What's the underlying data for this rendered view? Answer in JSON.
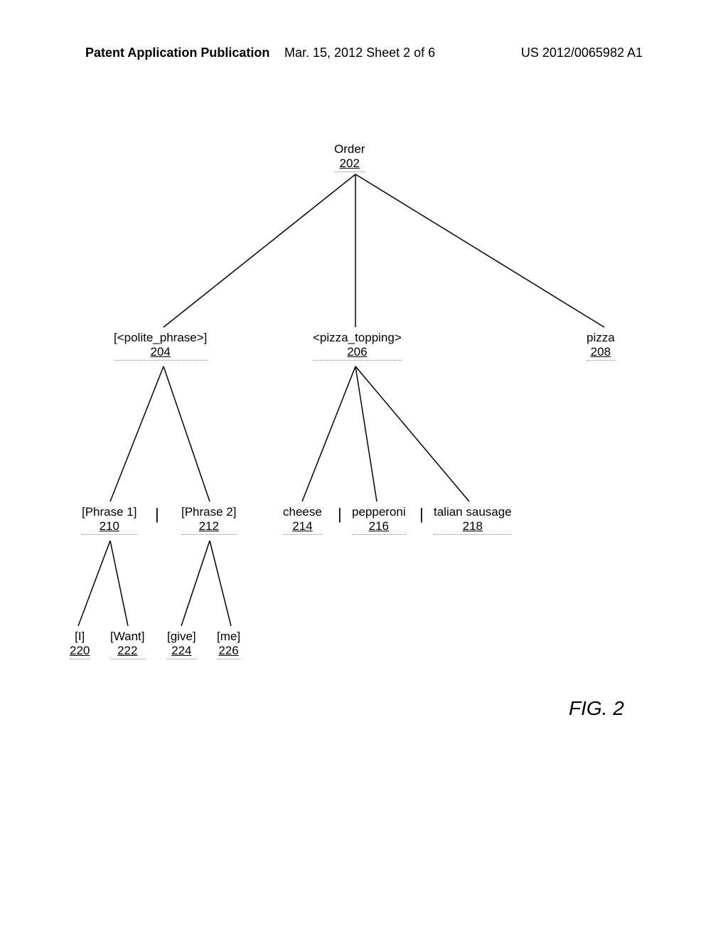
{
  "header": {
    "left": "Patent Application Publication",
    "center": "Mar. 15, 2012  Sheet 2 of 6",
    "right": "US 2012/0065982 A1"
  },
  "nodes": {
    "n202": {
      "label": "Order",
      "ref": "202"
    },
    "n204": {
      "label": "[<polite_phrase>]",
      "ref": "204"
    },
    "n206": {
      "label": "<pizza_topping>",
      "ref": "206"
    },
    "n208": {
      "label": "pizza",
      "ref": "208"
    },
    "n210": {
      "label": "[Phrase 1]",
      "ref": "210"
    },
    "n212": {
      "label": "[Phrase 2]",
      "ref": "212"
    },
    "n214": {
      "label": "cheese",
      "ref": "214"
    },
    "n216": {
      "label": "pepperoni",
      "ref": "216"
    },
    "n218": {
      "label": "talian sausage",
      "ref": "218"
    },
    "n220": {
      "label": "[I]",
      "ref": "220"
    },
    "n222": {
      "label": "[Want]",
      "ref": "222"
    },
    "n224": {
      "label": "[give]",
      "ref": "224"
    },
    "n226": {
      "label": "[me]",
      "ref": "226"
    }
  },
  "separators": {
    "s1": "|",
    "s2": "|",
    "s3": "|"
  },
  "figure_label": "FIG. 2",
  "chart_data": {
    "type": "table",
    "title": "Grammar parse tree for Order",
    "nodes": [
      {
        "id": 202,
        "label": "Order",
        "children": [
          204,
          206,
          208
        ]
      },
      {
        "id": 204,
        "label": "[<polite_phrase>]",
        "children": [
          210,
          212
        ]
      },
      {
        "id": 206,
        "label": "<pizza_topping>",
        "children": [
          214,
          216,
          218
        ]
      },
      {
        "id": 208,
        "label": "pizza",
        "children": []
      },
      {
        "id": 210,
        "label": "[Phrase 1]",
        "children": [
          220,
          222
        ]
      },
      {
        "id": 212,
        "label": "[Phrase 2]",
        "children": [
          224,
          226
        ]
      },
      {
        "id": 214,
        "label": "cheese",
        "children": []
      },
      {
        "id": 216,
        "label": "pepperoni",
        "children": []
      },
      {
        "id": 218,
        "label": "talian sausage",
        "children": []
      },
      {
        "id": 220,
        "label": "[I]",
        "children": []
      },
      {
        "id": 222,
        "label": "[Want]",
        "children": []
      },
      {
        "id": 224,
        "label": "[give]",
        "children": []
      },
      {
        "id": 226,
        "label": "[me]",
        "children": []
      }
    ]
  }
}
